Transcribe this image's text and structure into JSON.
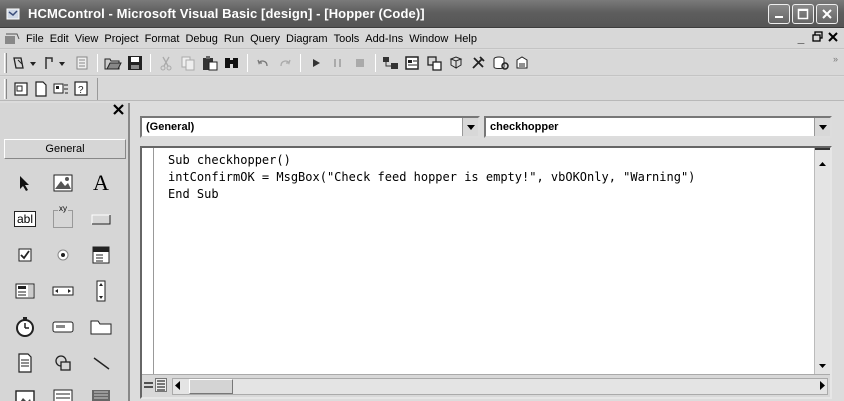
{
  "window": {
    "title": "HCMControl - Microsoft Visual Basic [design] - [Hopper (Code)]"
  },
  "menu": {
    "items": [
      "File",
      "Edit",
      "View",
      "Project",
      "Format",
      "Debug",
      "Run",
      "Query",
      "Diagram",
      "Tools",
      "Add-Ins",
      "Window",
      "Help"
    ],
    "mdi_buttons": [
      "_",
      "̈",
      "x"
    ]
  },
  "toolbox": {
    "close_glyph": "x",
    "tab_label": "General",
    "tools": [
      "pointer-icon",
      "picturebox-icon",
      "label-icon",
      "textbox-icon",
      "frame-icon",
      "commandbutton-icon",
      "checkbox-icon",
      "optionbutton-icon",
      "combobox-icon",
      "listbox-icon",
      "hscrollbar-icon",
      "vscrollbar-icon",
      "timer-icon",
      "drivelistbox-icon",
      "dirlistbox-icon",
      "filelistbox-icon",
      "shape-icon",
      "line-icon",
      "image-icon",
      "data-icon",
      "ole-icon"
    ],
    "label_glyph": "A",
    "textbox_glyph": "abl",
    "frame_glyph": "xy"
  },
  "editor": {
    "object_combo": "(General)",
    "procedure_combo": "checkhopper",
    "code_lines": [
      "Sub checkhopper()",
      "intConfirmOK = MsgBox(\"Check feed hopper is empty!\", vbOKOnly, \"Warning\")",
      "End Sub"
    ]
  },
  "colors": {
    "titlebar": "#5e5e5e",
    "chrome": "#d8d8d8",
    "editor_bg": "#ffffff"
  }
}
